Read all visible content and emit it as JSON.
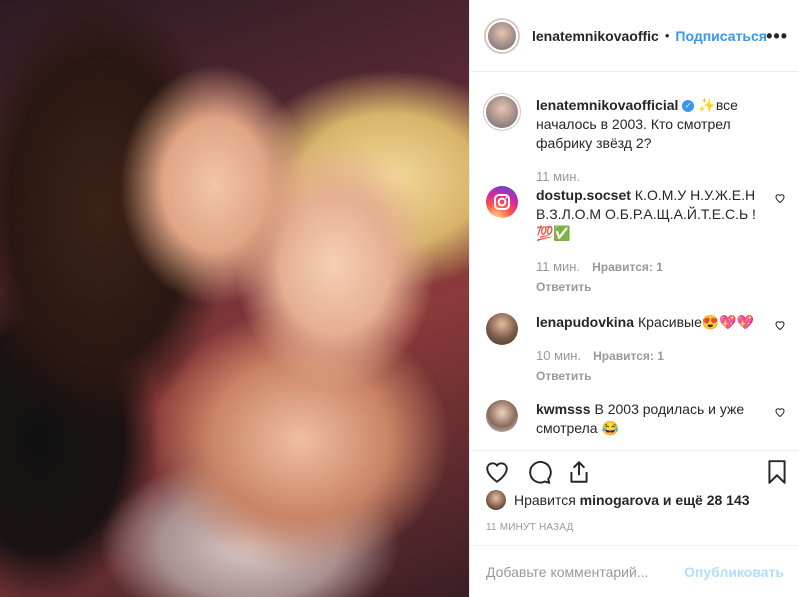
{
  "post": {
    "author": "lenatemnikovaoffic",
    "separator": "•",
    "follow_label": "Подписаться",
    "more_label": "•••"
  },
  "caption": {
    "user": "lenatemnikovaofficial",
    "verified_mark": "✓",
    "text": "✨все началось в 2003. Кто смотрел фабрику звёзд 2?",
    "time": "11 мин."
  },
  "comments": [
    {
      "user": "dostup.socset",
      "text": "К.О.М.У Н.У.Ж.Е.Н В.З.Л.О.М О.Б.Р.А.Щ.А.Й.Т.Е.С.Ь ! 💯✅",
      "time": "11 мин.",
      "likes": "Нравится: 1",
      "reply": "Ответить"
    },
    {
      "user": "lenapudovkina",
      "text": "Красивые😍💖💖",
      "time": "10 мин.",
      "likes": "Нравится: 1",
      "reply": "Ответить"
    },
    {
      "user": "kwmsss",
      "text": "В 2003 родилась и уже смотрела 😂"
    }
  ],
  "likes_line": {
    "prefix": "Нравится",
    "user": "minogarova",
    "suffix": "и ещё 28 143"
  },
  "post_time": "11 МИНУТ НАЗАД",
  "add_comment": {
    "placeholder": "Добавьте комментарий...",
    "publish_label": "Опубликовать"
  },
  "colors": {
    "accent": "#3897f0",
    "publish_disabled": "#b2dffc",
    "muted": "#999999"
  }
}
